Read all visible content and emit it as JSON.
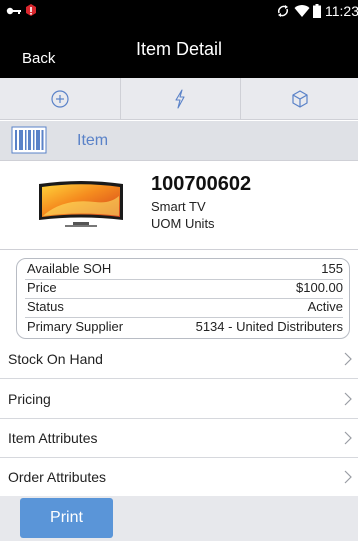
{
  "status_bar": {
    "time": "11:23",
    "icons": [
      "key-icon",
      "alert-icon",
      "sync-icon",
      "wifi-icon",
      "battery-icon"
    ]
  },
  "header": {
    "back_label": "Back",
    "title": "Item Detail"
  },
  "toolbar": {
    "buttons": [
      "plus-circle-icon",
      "lightning-icon",
      "cube-icon"
    ],
    "icon_color": "#5a82c8"
  },
  "item_section": {
    "label": "Item",
    "icon": "barcode-icon"
  },
  "product": {
    "item_number": "100700602",
    "description": "Smart TV",
    "uom": "UOM Units",
    "image": "tv-thumbnail"
  },
  "details": {
    "rows": [
      {
        "label": "Available SOH",
        "value": "155"
      },
      {
        "label": "Price",
        "value": "$100.00"
      },
      {
        "label": "Status",
        "value": "Active"
      },
      {
        "label": "Primary Supplier",
        "value": "5134 - United Distributers"
      }
    ]
  },
  "nav": {
    "items": [
      {
        "label": "Stock On Hand"
      },
      {
        "label": "Pricing"
      },
      {
        "label": "Item Attributes"
      },
      {
        "label": "Order Attributes"
      }
    ]
  },
  "footer": {
    "print_label": "Print",
    "accent": "#5a95d8"
  }
}
